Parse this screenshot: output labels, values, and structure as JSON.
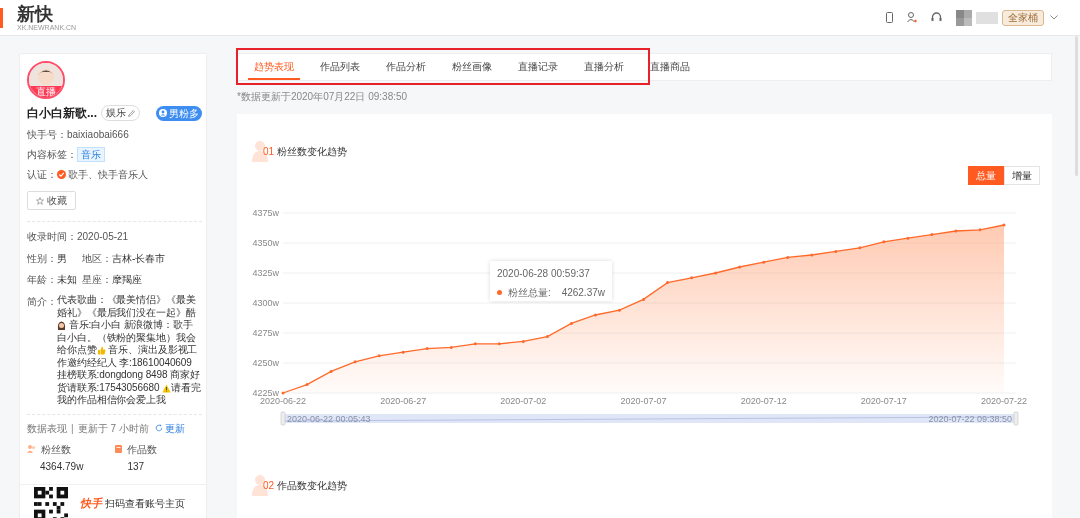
{
  "header": {
    "logo": "新快",
    "logo_sub": "XK.NEWRANK.CN",
    "badge": "全家桶"
  },
  "profile": {
    "avatar_badge": "直播",
    "name": "白小白新歌...",
    "category": "娱乐",
    "fan_badge": "男粉多",
    "fields": [
      {
        "label": "快手号：",
        "value": "baixiaobai666"
      }
    ],
    "content_tag_label": "内容标签：",
    "content_tag": "音乐",
    "verify_label": "认证：",
    "verify": "歌手、快手音乐人",
    "collect": "收藏",
    "recorded": "收录时间：2020-05-21",
    "info": [
      {
        "label": "性别：",
        "value": "男"
      },
      {
        "label": "地区：",
        "value": "吉林-长春市"
      },
      {
        "label": "年龄：",
        "value": "未知"
      },
      {
        "label": "星座：",
        "value": "摩羯座"
      }
    ],
    "bio_label": "简介：",
    "bio": [
      {
        "kind": "text",
        "text": "代表歌曲：《最美情侣》《最美婚礼》《最后我们没在一起》酷"
      },
      {
        "kind": "girl"
      },
      {
        "kind": "text",
        "text": " 音乐:白小白 新浪微博：歌手白小白。（铁粉的聚集地）我会给你点赞"
      },
      {
        "kind": "thumb"
      },
      {
        "kind": "text",
        "text": " 音乐、演出及影视工作邀约经纪人 李:18610040609 挂榜联系:dongdong 8498 商家好货请联系:17543056680 "
      },
      {
        "kind": "warning"
      },
      {
        "kind": "text",
        "text": "请看完我的作品相信你会爱上我"
      }
    ],
    "data_label": "数据表现",
    "separator": "|",
    "updated": "更新于 7 小时前",
    "refresh": "更新",
    "stats": [
      {
        "kind": "fans",
        "label": "粉丝数",
        "value": "4364.79w"
      },
      {
        "kind": "works",
        "label": "作品数",
        "value": "137"
      }
    ],
    "app_logo": "快手",
    "scan_text": "扫码查看账号主页"
  },
  "tabs": [
    {
      "label": "趋势表现",
      "selected": true
    },
    {
      "label": "作品列表",
      "selected": false
    },
    {
      "label": "作品分析",
      "selected": false
    },
    {
      "label": "粉丝画像",
      "selected": false
    },
    {
      "label": "直播记录",
      "selected": false
    },
    {
      "label": "直播分析",
      "selected": false
    },
    {
      "label": "直播商品",
      "selected": false
    }
  ],
  "update_note": "*数据更新于2020年07月22日 09:38:50",
  "sections": [
    {
      "number": "01",
      "title": "粉丝数变化趋势"
    },
    {
      "number": "02",
      "title": "作品数变化趋势"
    }
  ],
  "toggle": [
    {
      "label": "总量",
      "selected": true
    },
    {
      "label": "增量",
      "selected": false
    }
  ],
  "tooltip": {
    "time": "2020-06-28 00:59:37",
    "value": "4262.37w"
  },
  "range": {
    "start": "2020-06-22 00:05:43",
    "end": "2020-07-22 09:38:50"
  },
  "chart_data": {
    "type": "area",
    "categories": [
      "2020-06-22",
      null,
      null,
      null,
      null,
      "2020-06-27",
      null,
      null,
      null,
      null,
      "2020-07-02",
      null,
      null,
      null,
      null,
      "2020-07-07",
      null,
      null,
      null,
      null,
      "2020-07-12",
      null,
      null,
      null,
      null,
      "2020-07-17",
      null,
      null,
      null,
      null,
      "2020-07-22"
    ],
    "grid": true,
    "series": [
      {
        "name": "粉丝总量:",
        "color": "#ff6a2b",
        "values": [
          4225,
          4232,
          4243,
          4251,
          4256,
          4259,
          4262,
          4263,
          4266,
          4266,
          4268,
          4272,
          4283,
          4290,
          4294,
          4303,
          4317,
          4321,
          4325,
          4330,
          4334,
          4338,
          4340,
          4343,
          4346,
          4351,
          4354,
          4357,
          4360,
          4361,
          4365
        ]
      }
    ],
    "ylim": [
      4225,
      4375
    ],
    "yticks": [
      {
        "value": 4225,
        "label": "4225w"
      },
      {
        "value": 4250,
        "label": "4250w"
      },
      {
        "value": 4275,
        "label": "4275w"
      },
      {
        "value": 4300,
        "label": "4300w"
      },
      {
        "value": 4325,
        "label": "4325w"
      },
      {
        "value": 4350,
        "label": "4350w"
      },
      {
        "value": 4375,
        "label": "4375w"
      }
    ]
  }
}
